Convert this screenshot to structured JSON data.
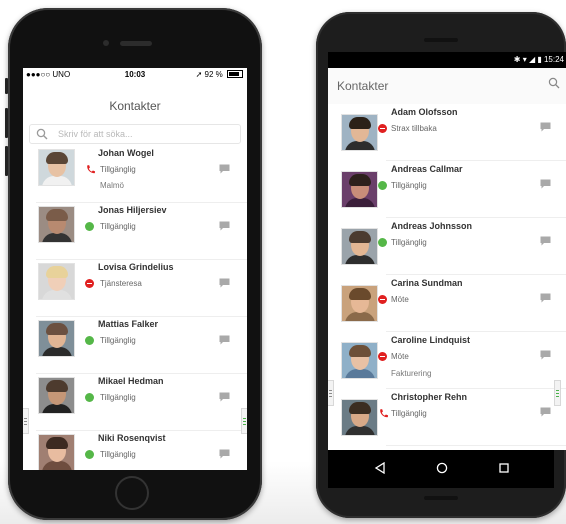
{
  "colors": {
    "available": "#55b748",
    "busy": "#e02020",
    "call": "#e02020",
    "chat": "#a9a9a9",
    "handle_left": "#8a8a8a",
    "handle_right": "#4bb14b"
  },
  "iphone": {
    "status": {
      "carrier": "●●●○○ UNO",
      "time": "10:03",
      "battery": "92 %"
    },
    "title": "Kontakter",
    "search_placeholder": "Skriv för att söka...",
    "contacts": [
      {
        "name": "Johan Wogel",
        "status": "Tillgänglig",
        "status_icon": "phone-icon",
        "note": "Malmö",
        "skin": "#e7c2a4",
        "hair": "#5a4636",
        "body": "#f1f1f1",
        "bg": "#cfd8dc"
      },
      {
        "name": "Jonas Hiljersiev",
        "status": "Tillgänglig",
        "status_icon": "available-dot",
        "note": "",
        "skin": "#b88a70",
        "hair": "#7a5c49",
        "body": "#333333",
        "bg": "#9b8c83"
      },
      {
        "name": "Lovisa Grindelius",
        "status": "Tjänsteresa",
        "status_icon": "busy-dot",
        "note": "",
        "skin": "#f0cfb8",
        "hair": "#e8d29a",
        "body": "#e0e0e0",
        "bg": "#d8d8d8"
      },
      {
        "name": "Mattias Falker",
        "status": "Tillgänglig",
        "status_icon": "available-dot",
        "note": "",
        "skin": "#e1b594",
        "hair": "#6b5040",
        "body": "#2b2b2b",
        "bg": "#7f8f99"
      },
      {
        "name": "Mikael Hedman",
        "status": "Tillgänglig",
        "status_icon": "available-dot",
        "note": "",
        "skin": "#c59777",
        "hair": "#4d3b2e",
        "body": "#222222",
        "bg": "#8d8d8d"
      },
      {
        "name": "Niki Rosenqvist",
        "status": "Tillgänglig",
        "status_icon": "available-dot",
        "note": "",
        "skin": "#e8bca0",
        "hair": "#3d2a21",
        "body": "#6e4d3f",
        "bg": "#a07f72"
      }
    ]
  },
  "android": {
    "status": {
      "time": "15:24"
    },
    "title": "Kontakter",
    "contacts": [
      {
        "name": "Adam Olofsson",
        "status": "Strax tillbaka",
        "status_icon": "busy-dot",
        "note": "",
        "skin": "#e2b796",
        "hair": "#2b2118",
        "body": "#2d2d2d",
        "bg": "#9fb3c3"
      },
      {
        "name": "Andreas Callmar",
        "status": "Tillgänglig",
        "status_icon": "available-dot",
        "note": "",
        "skin": "#c88e79",
        "hair": "#2d211c",
        "body": "#3b1f3a",
        "bg": "#6a3f6a"
      },
      {
        "name": "Andreas Johnsson",
        "status": "Tillgänglig",
        "status_icon": "available-dot",
        "note": "",
        "skin": "#e3b794",
        "hair": "#4b3b30",
        "body": "#2e2e2e",
        "bg": "#9aa3aa"
      },
      {
        "name": "Carina Sundman",
        "status": "Möte",
        "status_icon": "busy-dot",
        "note": "",
        "skin": "#e6b896",
        "hair": "#6a4a2c",
        "body": "#8a6a4a",
        "bg": "#c9a27c"
      },
      {
        "name": "Caroline Lindquist",
        "status": "Möte",
        "status_icon": "busy-dot",
        "note": "Fakturering",
        "skin": "#e8c1a4",
        "hair": "#6d5038",
        "body": "#5a7a9a",
        "bg": "#8fb0c8"
      },
      {
        "name": "Christopher Rehn",
        "status": "Tillgänglig",
        "status_icon": "phone-icon",
        "note": "",
        "skin": "#d8a988",
        "hair": "#3b2d22",
        "body": "#303030",
        "bg": "#6b7c86"
      }
    ],
    "nav": [
      "back",
      "home",
      "recents"
    ]
  }
}
